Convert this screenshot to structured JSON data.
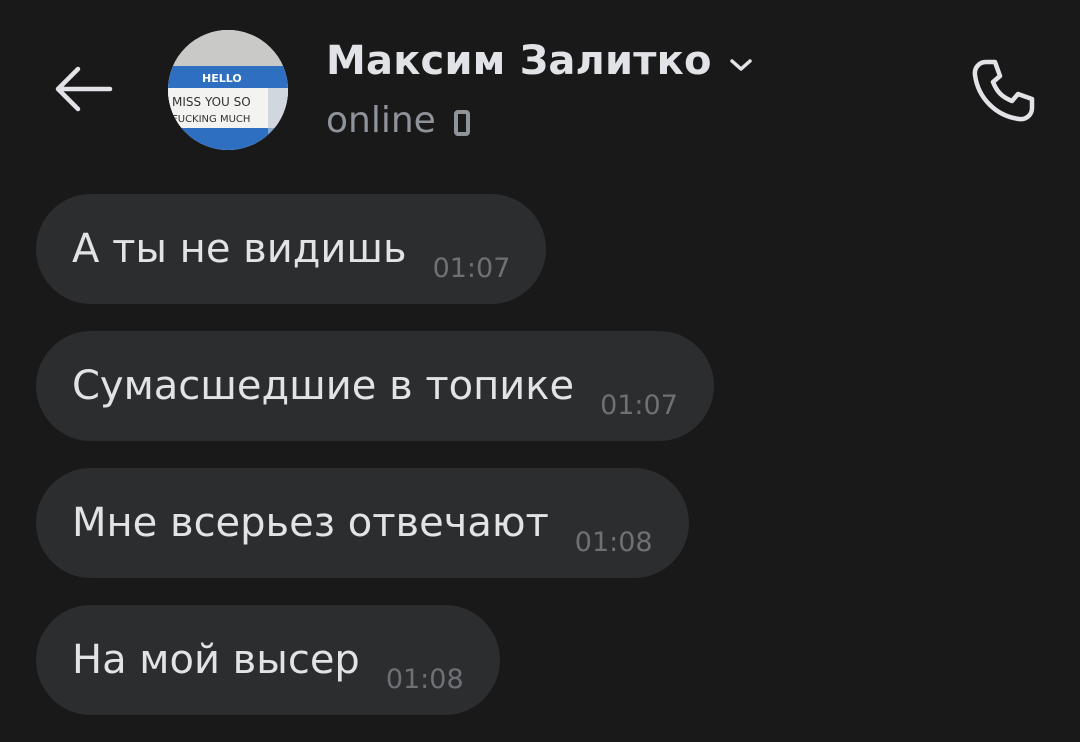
{
  "header": {
    "contact_name": "Максим Залитко",
    "status": "online",
    "avatar": {
      "top_text": "HELLO",
      "line1": "MISS YOU SO",
      "line2": "FUCKING MUCH"
    }
  },
  "messages": [
    {
      "text": "А ты не видишь",
      "time": "01:07"
    },
    {
      "text": "Сумасшедшие в топике",
      "time": "01:07"
    },
    {
      "text": "Мне всерьез отвечают",
      "time": "01:08"
    },
    {
      "text": "На мой высер",
      "time": "01:08"
    }
  ],
  "colors": {
    "background": "#19191a",
    "bubble": "#2c2d2f",
    "text": "#e1e3e6",
    "secondary_text": "#8f949a",
    "time_text": "#6d7175"
  },
  "icons": {
    "back": "arrow-left-icon",
    "dropdown": "chevron-down-icon",
    "device": "mobile-device-icon",
    "call": "phone-icon"
  }
}
